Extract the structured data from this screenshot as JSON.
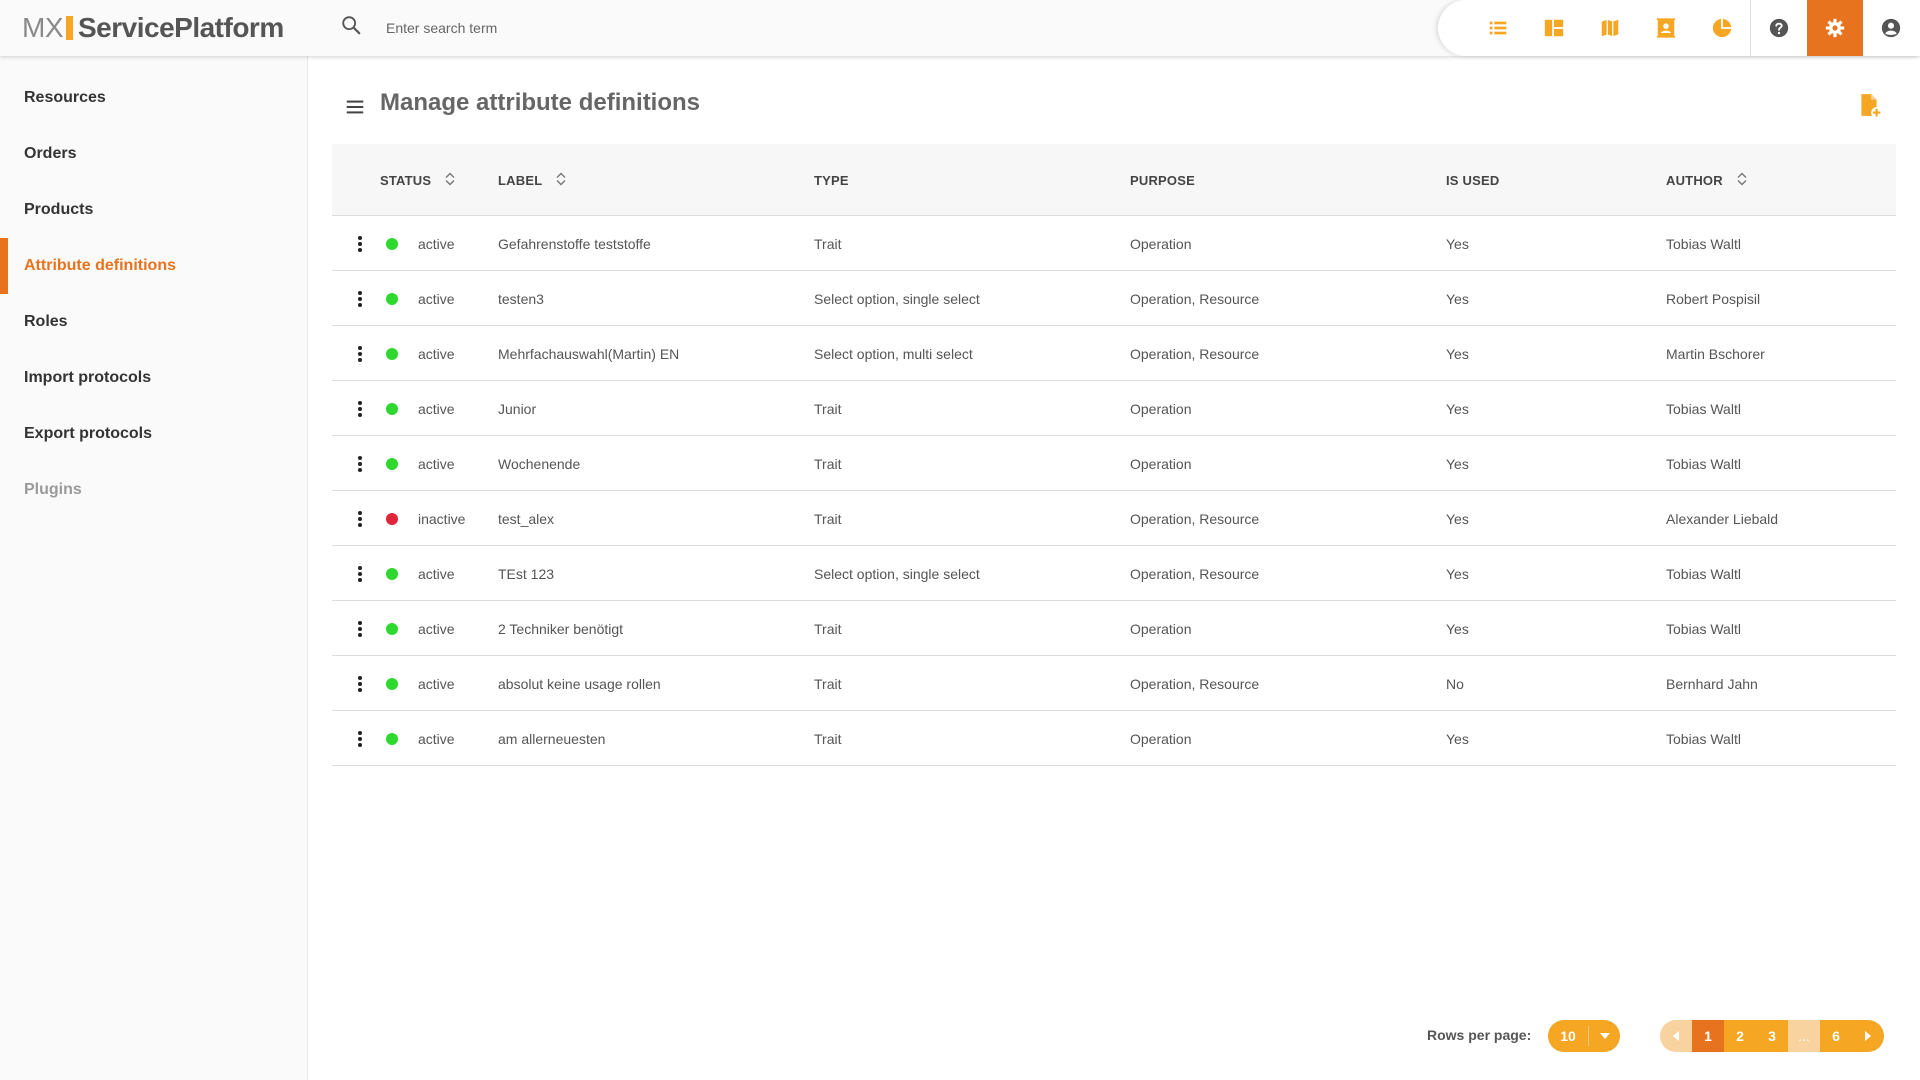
{
  "header": {
    "logo_mx": "MX",
    "logo_service": "ServicePlatform",
    "search_placeholder": "Enter search term",
    "toolbar_icons": [
      "list-icon",
      "dashboard-icon",
      "map-icon",
      "contacts-icon",
      "pie-chart-icon",
      "help-icon",
      "settings-icon",
      "account-icon"
    ]
  },
  "colors": {
    "accent": "#e8731e",
    "yellow": "#f5a623",
    "status_active": "#2ed82e",
    "status_inactive": "#e0243a"
  },
  "sidebar": {
    "items": [
      {
        "label": "Resources"
      },
      {
        "label": "Orders"
      },
      {
        "label": "Products"
      },
      {
        "label": "Attribute definitions"
      },
      {
        "label": "Roles"
      },
      {
        "label": "Import protocols"
      },
      {
        "label": "Export protocols"
      },
      {
        "label": "Plugins"
      }
    ]
  },
  "main": {
    "title": "Manage attribute definitions",
    "columns": {
      "status": "STATUS",
      "label": "LABEL",
      "type": "TYPE",
      "purpose": "PURPOSE",
      "is_used": "IS USED",
      "author": "AUTHOR"
    },
    "rows": [
      {
        "status": "active",
        "label": "Gefahrenstoffe teststoffe",
        "type": "Trait",
        "purpose": "Operation",
        "is_used": "Yes",
        "author": "Tobias Waltl"
      },
      {
        "status": "active",
        "label": "testen3",
        "type": "Select option, single select",
        "purpose": "Operation, Resource",
        "is_used": "Yes",
        "author": "Robert Pospisil"
      },
      {
        "status": "active",
        "label": "Mehrfachauswahl(Martin) EN",
        "type": "Select option, multi select",
        "purpose": "Operation, Resource",
        "is_used": "Yes",
        "author": "Martin Bschorer"
      },
      {
        "status": "active",
        "label": "Junior",
        "type": "Trait",
        "purpose": "Operation",
        "is_used": "Yes",
        "author": "Tobias Waltl"
      },
      {
        "status": "active",
        "label": "Wochenende",
        "type": "Trait",
        "purpose": "Operation",
        "is_used": "Yes",
        "author": "Tobias Waltl"
      },
      {
        "status": "inactive",
        "label": "test_alex",
        "type": "Trait",
        "purpose": "Operation, Resource",
        "is_used": "Yes",
        "author": "Alexander Liebald"
      },
      {
        "status": "active",
        "label": "TEst 123",
        "type": "Select option, single select",
        "purpose": "Operation, Resource",
        "is_used": "Yes",
        "author": "Tobias Waltl"
      },
      {
        "status": "active",
        "label": "2 Techniker benötigt",
        "type": "Trait",
        "purpose": "Operation",
        "is_used": "Yes",
        "author": "Tobias Waltl"
      },
      {
        "status": "active",
        "label": "absolut keine usage rollen",
        "type": "Trait",
        "purpose": "Operation, Resource",
        "is_used": "No",
        "author": "Bernhard Jahn"
      },
      {
        "status": "active",
        "label": "am allerneuesten",
        "type": "Trait",
        "purpose": "Operation",
        "is_used": "Yes",
        "author": "Tobias Waltl"
      }
    ]
  },
  "pagination": {
    "rows_per_page_label": "Rows per page:",
    "rows_per_page": "10",
    "pages": [
      "1",
      "2",
      "3",
      "...",
      "6"
    ]
  }
}
